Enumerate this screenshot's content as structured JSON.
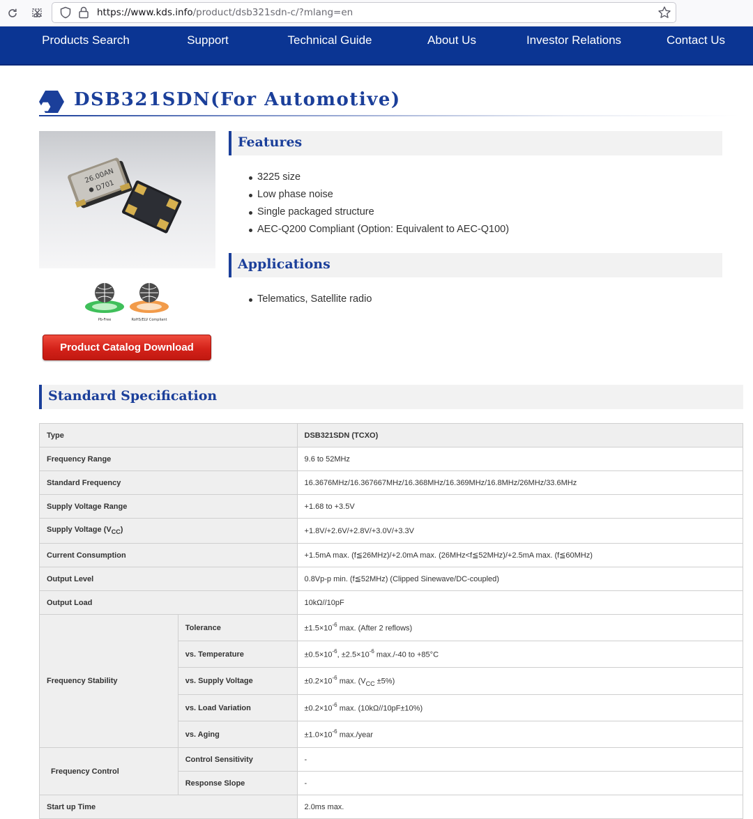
{
  "browser": {
    "url_host": "https://www.kds.info",
    "url_path": "/product/dsb321sdn-c/?mlang=en"
  },
  "nav": {
    "items": [
      "Products Search",
      "Support",
      "Technical Guide",
      "About Us",
      "Investor Relations",
      "Contact Us"
    ]
  },
  "page": {
    "title": "DSB321SDN(For Automotive)"
  },
  "product_image": {
    "chip_text_line1": "26.00AN",
    "chip_text_line2": "D701",
    "badge1": "Pb-Free",
    "badge2": "RoHS/ELV Compliant"
  },
  "catalog_button": "Product Catalog Download",
  "features": {
    "heading": "Features",
    "items": [
      "3225 size",
      "Low phase noise",
      "Single packaged structure",
      "AEC-Q200 Compliant (Option: Equivalent to AEC-Q100)"
    ]
  },
  "applications": {
    "heading": "Applications",
    "items": [
      "Telematics, Satellite radio"
    ]
  },
  "spec": {
    "heading": "Standard Specification",
    "type_label": "Type",
    "type_value": "DSB321SDN (TCXO)",
    "freq_range_label": "Frequency Range",
    "freq_range_value": "9.6 to 52MHz",
    "std_freq_label": "Standard Frequency",
    "std_freq_value": "16.3676MHz/16.367667MHz/16.368MHz/16.369MHz/16.8MHz/26MHz/33.6MHz",
    "supply_range_label": "Supply Voltage Range",
    "supply_range_value": "+1.68 to +3.5V",
    "supply_v_label": "Supply Voltage (V",
    "supply_v_sub": "CC",
    "supply_v_close": ")",
    "supply_v_value": "+1.8V/+2.6V/+2.8V/+3.0V/+3.3V",
    "current_label": "Current Consumption",
    "current_value": "+1.5mA max. (f≦26MHz)/+2.0mA max. (26MHz<f≦52MHz)/+2.5mA max. (f≦60MHz)",
    "output_level_label": "Output Level",
    "output_level_value": "0.8Vp-p min. (f≦52MHz) (Clipped Sinewave/DC-coupled)",
    "output_load_label": "Output Load",
    "output_load_value": "10kΩ//10pF",
    "freq_stability_label": "Frequency Stability",
    "tolerance_label": "Tolerance",
    "tolerance_pre": "±1.5×10",
    "tolerance_exp": "-6",
    "tolerance_post": " max. (After 2 reflows)",
    "temp_label": "vs. Temperature",
    "temp_pre1": "±0.5×10",
    "temp_exp1": "-6",
    "temp_mid": ", ±2.5×10",
    "temp_exp2": "-6",
    "temp_post": " max./-40 to +85°C",
    "supplyv_label": "vs. Supply Voltage",
    "supplyv_pre": "±0.2×10",
    "supplyv_exp": "-6",
    "supplyv_mid": " max. (V",
    "supplyv_sub": "CC",
    "supplyv_post": " ±5%)",
    "load_label": "vs. Load Variation",
    "load_pre": "±0.2×10",
    "load_exp": "-6",
    "load_post": " max. (10kΩ//10pF±10%)",
    "aging_label": "vs. Aging",
    "aging_pre": "±1.0×10",
    "aging_exp": "-6",
    "aging_post": " max./year",
    "freq_control_label": "Frequency Control",
    "ctrl_sens_label": "Control Sensitivity",
    "ctrl_sens_value": "-",
    "resp_slope_label": "Response Slope",
    "resp_slope_value": "-",
    "startup_label": "Start up Time",
    "startup_value": "2.0ms max."
  },
  "colors": {
    "brand_blue": "#0b3593",
    "heading_blue": "#1b3f9a",
    "button_red": "#d4221a"
  }
}
